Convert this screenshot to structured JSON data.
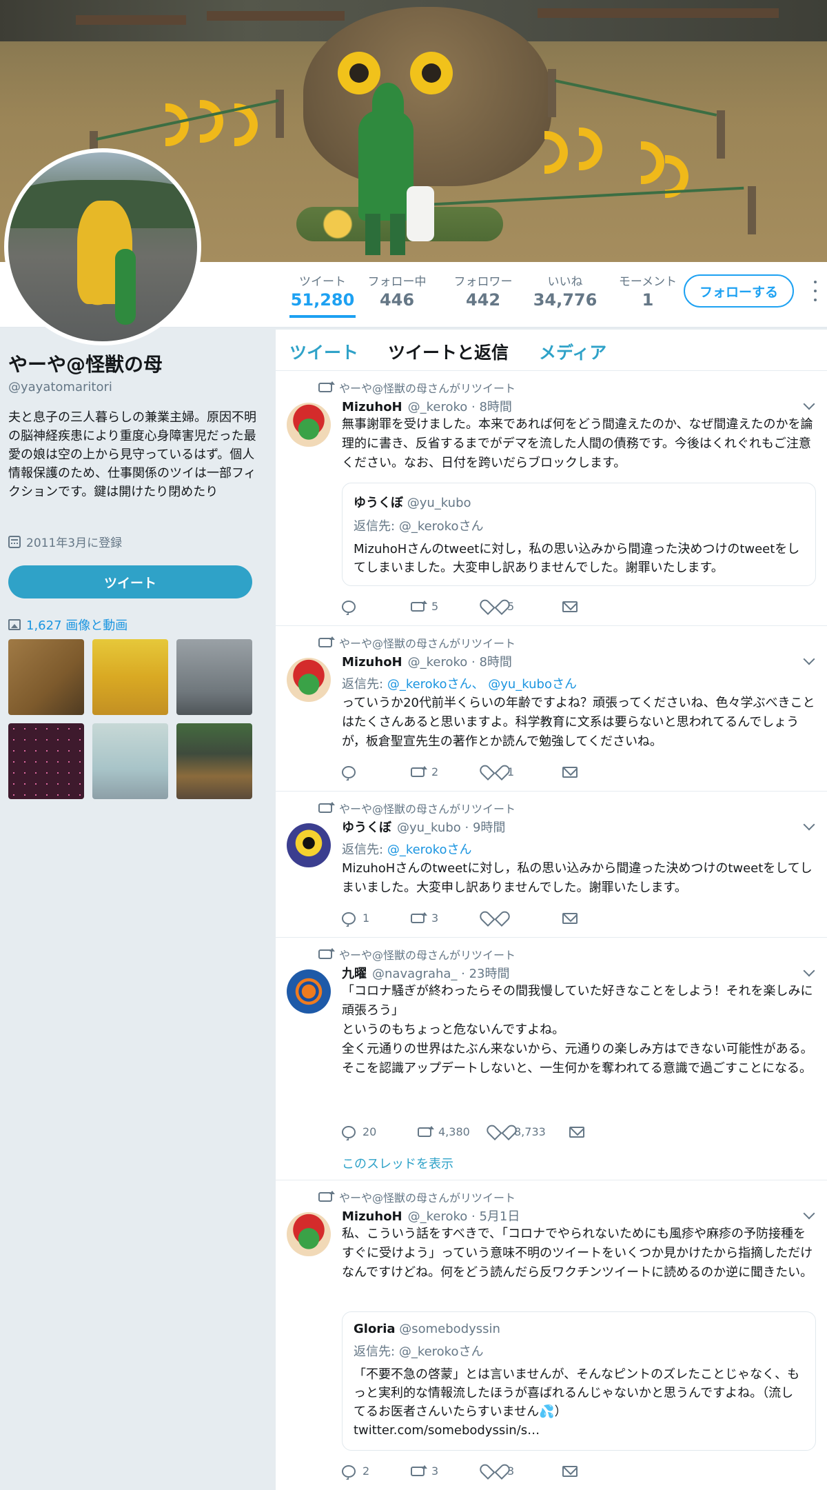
{
  "profile": {
    "stats": [
      {
        "label": "ツイート",
        "value": "51,280"
      },
      {
        "label": "フォロー中",
        "value": "446"
      },
      {
        "label": "フォロワー",
        "value": "442"
      },
      {
        "label": "いいね",
        "value": "34,776"
      },
      {
        "label": "モーメント",
        "value": "1"
      }
    ],
    "follow_label": "フォローする",
    "name": "やーや@怪獣の母",
    "handle": "@yayatomaritori",
    "bio": "夫と息子の三人暮らしの兼業主婦。原因不明の脳神経疾患により重度心身障害児だった最愛の娘は空の上から見守っているはず。個人情報保護のため、仕事関係のツイは一部フィクションです。鍵は開けたり閉めたり",
    "joined": "2011年3月に登録",
    "tweet_button": "ツイート",
    "media_link": "1,627 画像と動画"
  },
  "tabs": [
    "ツイート",
    "ツイートと返信",
    "メディア"
  ],
  "tweets": [
    {
      "rt": "やーや@怪獣の母さんがリツイート",
      "name": "MizuhoH",
      "meta": "@_keroko · 8時間",
      "text": "無事謝罪を受けました。本来であれば何をどう間違えたのか、なぜ間違えたのかを論理的に書き、反省するまでがデマを流した人間の債務です。今後はくれぐれもご注意ください。なお、日付を跨いだらブロックします。",
      "quote": {
        "name": "ゆうくぼ",
        "handle": "@yu_kubo",
        "reply_prefix": "返信先:",
        "reply_to": "@_kerokoさん",
        "text": "MizuhoHさんのtweetに対し，私の思い込みから間違った決めつけのtweetをしてしまいました。大変申し訳ありませんでした。謝罪いたします。"
      },
      "replies": "",
      "retweets": "5",
      "likes": "5"
    },
    {
      "rt": "やーや@怪獣の母さんがリツイート",
      "name": "MizuhoH",
      "meta": "@_keroko · 8時間",
      "reply_prefix": "返信先:",
      "reply_to_1": "@_kerokoさん、",
      "reply_to_2": "@yu_kuboさん",
      "text": "っていうか20代前半くらいの年齢ですよね？頑張ってくださいね、色々学ぶべきことはたくさんあると思いますよ。科学教育に文系は要らないと思われてるんでしょうが，板倉聖宣先生の著作とか読んで勉強してくださいね。",
      "replies": "",
      "retweets": "2",
      "likes": "1"
    },
    {
      "rt": "やーや@怪獣の母さんがリツイート",
      "name": "ゆうくぼ",
      "meta": "@yu_kubo · 9時間",
      "reply_prefix": "返信先:",
      "reply_to": "@_kerokoさん",
      "text": "MizuhoHさんのtweetに対し，私の思い込みから間違った決めつけのtweetをしてしまいました。大変申し訳ありませんでした。謝罪いたします。",
      "replies": "1",
      "retweets": "3",
      "likes": ""
    },
    {
      "rt": "やーや@怪獣の母さんがリツイート",
      "name": "九曜",
      "meta": "@navagraha_ · 23時間",
      "text": "「コロナ騒ぎが終わったらその間我慢していた好きなことをしよう！それを楽しみに頑張ろう」\nというのもちょっと危ないんですよね。\n全く元通りの世界はたぶん来ないから、元通りの楽しみ方はできない可能性がある。\nそこを認識アップデートしないと、一生何かを奪われてる意識で過ごすことになる。",
      "replies": "20",
      "retweets": "4,380",
      "likes": "8,733",
      "thread": "このスレッドを表示"
    },
    {
      "rt": "やーや@怪獣の母さんがリツイート",
      "name": "MizuhoH",
      "meta": "@_keroko · 5月1日",
      "text": "私、こういう話をすべきで、「コロナでやられないためにも風疹や麻疹の予防接種をすぐに受けよう」っていう意味不明のツイートをいくつか見かけたから指摘しただけなんですけどね。何をどう読んだら反ワクチンツイートに読めるのか逆に聞きたい。",
      "quote": {
        "name": "Gloria",
        "handle": "@somebodyssin",
        "reply_prefix": "返信先:",
        "reply_to": "@_kerokoさん",
        "text": "「不要不急の啓蒙」とは言いませんが、そんなピントのズレたことじゃなく、もっと実利的な情報流したほうが喜ばれるんじゃないかと思うんですよね。（流してるお医者さんいたらすいません💦）\ntwitter.com/somebodyssin/s…"
      },
      "replies": "2",
      "retweets": "3",
      "likes": "3"
    }
  ]
}
